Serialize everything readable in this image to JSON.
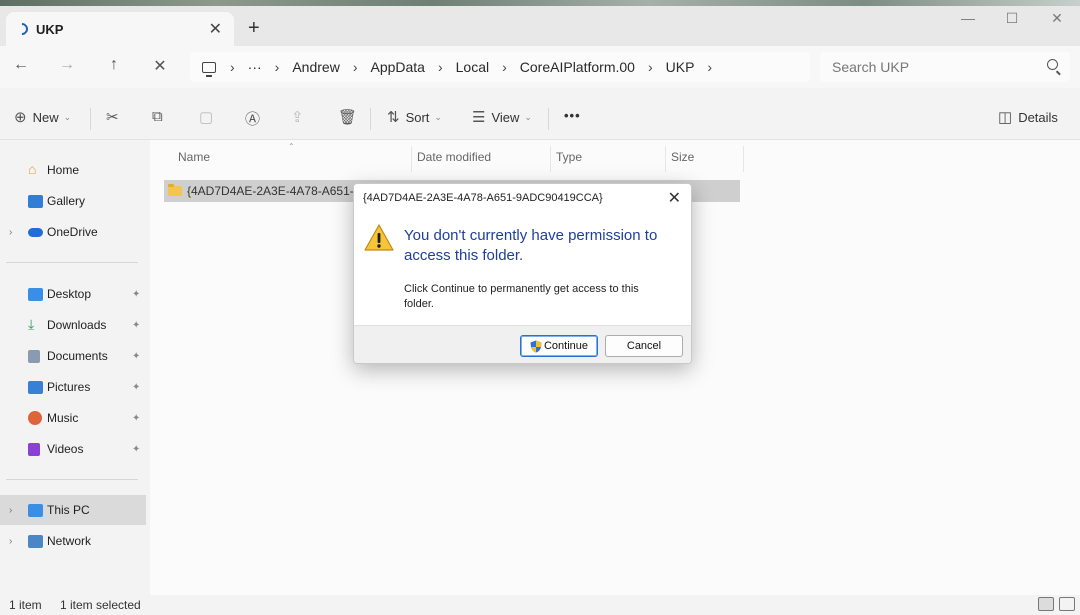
{
  "window": {
    "tab_label": "UKP",
    "new_tab_glyph": "+",
    "tab_close_glyph": "✕",
    "controls": {
      "minimize": "—",
      "maximize": "☐",
      "close": "✕"
    }
  },
  "nav": {
    "back": "←",
    "forward": "→",
    "up": "↑",
    "stop": "✕"
  },
  "address": {
    "overflow": "···",
    "sep": "›",
    "crumbs": [
      "Andrew",
      "AppData",
      "Local",
      "CoreAIPlatform.00",
      "UKP"
    ],
    "search_placeholder": "Search UKP"
  },
  "commands": {
    "new_label": "New",
    "sort_label": "Sort",
    "view_label": "View",
    "more": "•••",
    "details_label": "Details",
    "icons": [
      "cut-icon",
      "copy-icon",
      "paste-icon",
      "rename-icon",
      "share-icon",
      "delete-icon"
    ]
  },
  "sidebar": {
    "top": [
      {
        "label": "Home",
        "icon": "home-icon",
        "color": "#e69b3c"
      },
      {
        "label": "Gallery",
        "icon": "gallery-icon",
        "color": "#2f7fd6"
      },
      {
        "label": "OneDrive",
        "icon": "cloud-icon",
        "color": "#1f6fd0"
      }
    ],
    "quick_access": [
      {
        "label": "Desktop",
        "color": "#3a8ee6"
      },
      {
        "label": "Downloads",
        "color": "#2f9a5a"
      },
      {
        "label": "Documents",
        "color": "#8a9bb0"
      },
      {
        "label": "Pictures",
        "color": "#3a7fd6"
      },
      {
        "label": "Music",
        "color": "#e0643a"
      },
      {
        "label": "Videos",
        "color": "#8a3fd6"
      }
    ],
    "bottom": [
      {
        "label": "This PC",
        "color": "#3a8ee6"
      },
      {
        "label": "Network",
        "color": "#4a86c8"
      }
    ],
    "pin_glyph": "✦",
    "expand_glyph": "›"
  },
  "columns": {
    "name": "Name",
    "date_modified": "Date modified",
    "type": "Type",
    "size": "Size"
  },
  "files": [
    {
      "name": "{4AD7D4AE-2A3E-4A78-A651-9A"
    }
  ],
  "status": {
    "item_count": "1 item",
    "selected": "1 item selected"
  },
  "dialog": {
    "title": "{4AD7D4AE-2A3E-4A78-A651-9ADC90419CCA}",
    "close": "✕",
    "heading": "You don't currently have permission to access this folder.",
    "body": "Click Continue to permanently get access to this folder.",
    "continue_label": "Continue",
    "cancel_label": "Cancel",
    "heading_color": "#1e3f9a"
  }
}
